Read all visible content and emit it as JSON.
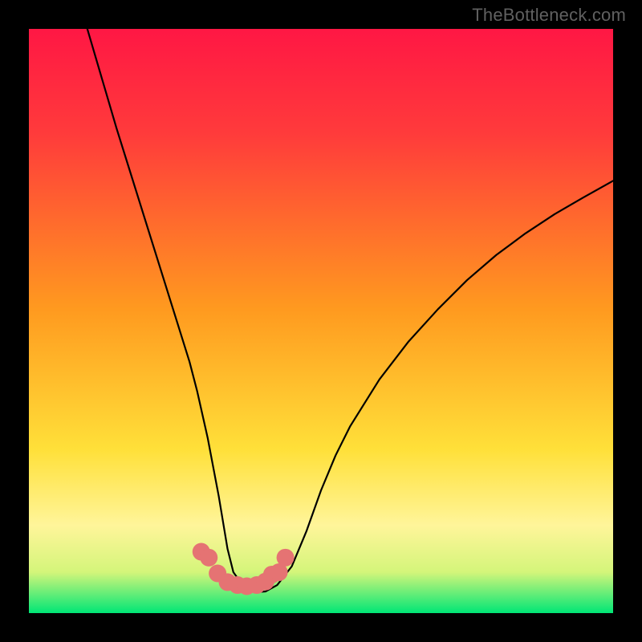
{
  "watermark": "TheBottleneck.com",
  "chart_data": {
    "type": "line",
    "title": "",
    "xlabel": "",
    "ylabel": "",
    "xlim": [
      0,
      100
    ],
    "ylim": [
      0,
      100
    ],
    "background_gradient": {
      "top_color": "#ff1744",
      "mid_color": "#ffe039",
      "lower_band_color": "#fff59a",
      "bottom_color": "#00e676"
    },
    "series": [
      {
        "name": "curve",
        "color": "#000000",
        "stroke_width": 2.2,
        "x": [
          10,
          12.5,
          15,
          17.5,
          20,
          22.5,
          25,
          27.5,
          28.8,
          30.6,
          32.5,
          34,
          35,
          37,
          39,
          40.5,
          42.5,
          45,
          47.5,
          50,
          52.5,
          55,
          60,
          65,
          70,
          75,
          80,
          85,
          90,
          95,
          100
        ],
        "values": [
          100,
          91.5,
          83,
          75,
          67,
          59,
          51,
          43,
          38,
          30,
          20,
          11,
          7,
          4.2,
          3.6,
          3.7,
          4.8,
          8,
          14,
          21,
          27,
          32,
          40,
          46.5,
          52,
          57,
          61.3,
          65,
          68.3,
          71.2,
          74
        ]
      }
    ],
    "markers": {
      "color": "#e57373",
      "radius": 11,
      "points_xy": [
        [
          29.5,
          10.5
        ],
        [
          30.8,
          9.5
        ],
        [
          32.3,
          6.8
        ],
        [
          34.0,
          5.3
        ],
        [
          35.7,
          4.8
        ],
        [
          37.3,
          4.6
        ],
        [
          39.0,
          4.8
        ],
        [
          40.5,
          5.4
        ],
        [
          41.6,
          6.6
        ],
        [
          42.8,
          7.0
        ],
        [
          43.9,
          9.5
        ]
      ]
    }
  }
}
